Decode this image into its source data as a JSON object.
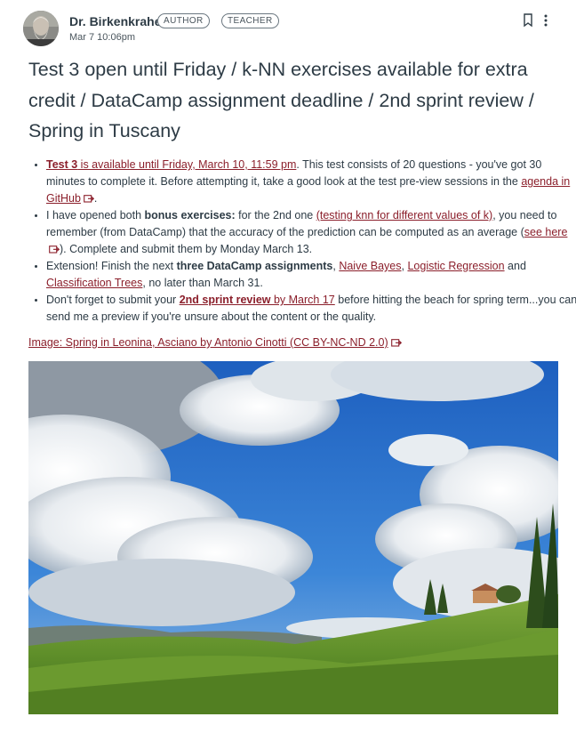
{
  "author": {
    "name": "Dr. Birkenkrahe",
    "badges": [
      "AUTHOR",
      "TEACHER"
    ],
    "date": "Mar 7 10:06pm"
  },
  "title": "Test 3 open until Friday / k-NN exercises available for extra credit / DataCamp assignment deadline / 2nd sprint review / Spring in Tuscany",
  "bullets": {
    "b1": {
      "link_test3": "Test 3",
      "link_available": " is available until Friday, March 10, 11:59 pm",
      "text1": ". This test consists of 20 questions - you've got 30 minutes to complete it. Before attempting it, take a good look at the test pre-view sessions in the ",
      "link_agenda": "agenda in GitHub"
    },
    "b2": {
      "text1": "I have opened both ",
      "bold1": "bonus exercises:",
      "text2": " for the 2nd one ",
      "link1": "(testing knn for different values of k)",
      "text3": ", you need to remember (from DataCamp) that the accuracy of the prediction can be computed as an average (",
      "link2": "see here",
      "text4": "). Complete and submit them by Monday March 13."
    },
    "b3": {
      "text1": "Extension! Finish the next ",
      "bold1": "three DataCamp assignments",
      "text2": ", ",
      "link1": "Naive Bayes",
      "text3": ", ",
      "link2": "Logistic Regression",
      "text4": " and ",
      "link3": "Classification Trees",
      "text5": ", no later than March 31."
    },
    "b4": {
      "text1": "Don't forget to submit your ",
      "link_bold": "2nd sprint review",
      "link2": " by March 17",
      "text2": " before hitting the beach for spring term...you can send me a preview if you're unsure about the content or the quality."
    }
  },
  "image_caption": "Image: Spring in Leonina, Asciano by Antonio Cinotti (CC BY-NC-ND 2.0)",
  "icons": {
    "bookmark": "bookmark-icon",
    "more": "more-vertical-icon",
    "external": "external-link-icon"
  },
  "colors": {
    "link": "#8b1f2b",
    "text": "#2d3b45",
    "sky": "#2a6fc9"
  }
}
